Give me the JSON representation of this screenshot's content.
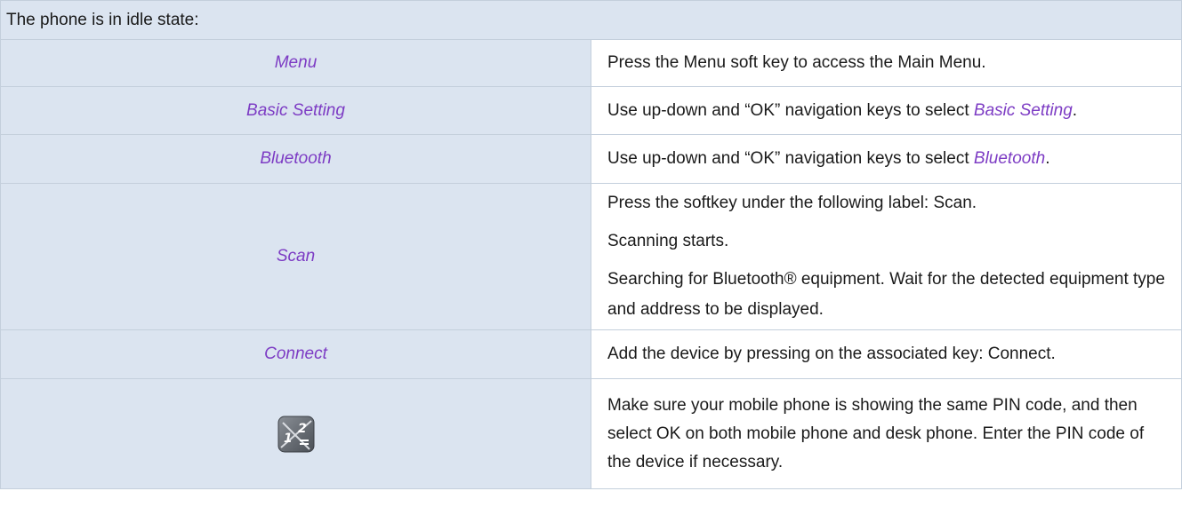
{
  "table": {
    "header": "The phone is in idle state:",
    "rows": [
      {
        "label": "Menu",
        "text": "Press the Menu soft key to access the Main Menu."
      },
      {
        "label": "Basic Setting",
        "pre": "Use up-down and “OK” navigation keys to select ",
        "ref": "Basic Setting",
        "post": "."
      },
      {
        "label": "Bluetooth",
        "pre": "Use up-down and “OK” navigation keys to select ",
        "ref": "Bluetooth",
        "post": "."
      },
      {
        "label": "Scan",
        "paragraphs": [
          "Press the softkey under the following label: Scan.",
          "Scanning starts.",
          "Searching for Bluetooth® equipment. Wait for the detected equipment type and address to be displayed."
        ]
      },
      {
        "label": "Connect",
        "text": "Add the device by pressing on the associated key: Connect."
      },
      {
        "icon": "keypad-icon",
        "text": "Make sure your mobile phone is showing the same PIN code, and then select OK on both mobile phone and desk phone. Enter the PIN code of the device if necessary."
      }
    ]
  },
  "colors": {
    "header_bg": "#dbe4f0",
    "label_color": "#7d3cc4",
    "border": "#c4cfdc"
  }
}
